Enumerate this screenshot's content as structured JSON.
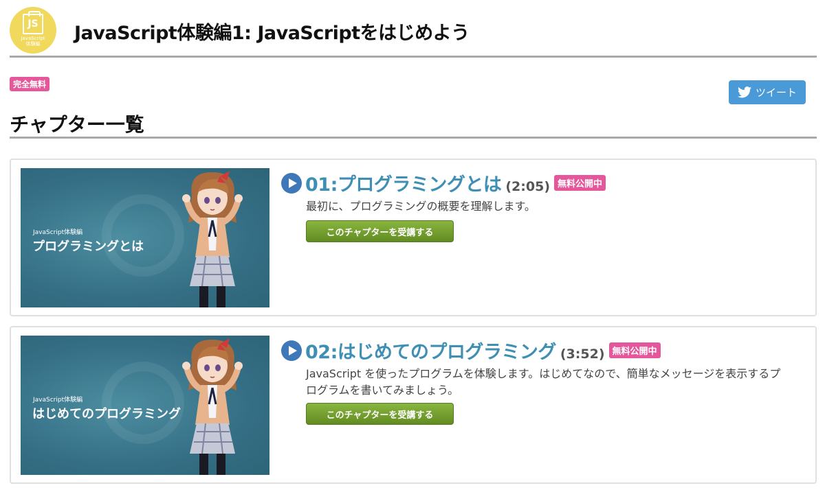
{
  "header": {
    "logo_js": "JS",
    "logo_text1": "JavaScript",
    "logo_text2": "体験編",
    "title": "JavaScript体験編1: JavaScriptをはじめよう"
  },
  "badge_free": "完全無料",
  "tweet_label": "ツイート",
  "section_title": "チャプター一覧",
  "chapters": [
    {
      "title": "01:プログラミングとは",
      "duration": "(2:05)",
      "badge": "無料公開中",
      "desc": "最初に、プログラミングの概要を理解します。",
      "button": "このチャプターを受講する",
      "thumb_sub": "JavaScript体験編",
      "thumb_title": "プログラミングとは"
    },
    {
      "title": "02:はじめてのプログラミング",
      "duration": "(3:52)",
      "badge": "無料公開中",
      "desc": "JavaScript を使ったプログラムを体験します。はじめてなので、簡単なメッセージを表示するプログラムを書いてみましょう。",
      "button": "このチャプターを受講する",
      "thumb_sub": "JavaScript体験編",
      "thumb_title": "はじめてのプログラミング"
    }
  ],
  "colors": {
    "accent_pink": "#e4579a",
    "link_blue": "#3f8fb5",
    "button_green": "#6f9a2a",
    "tweet_blue": "#4a9ad8",
    "logo_yellow": "#f0d95c"
  }
}
